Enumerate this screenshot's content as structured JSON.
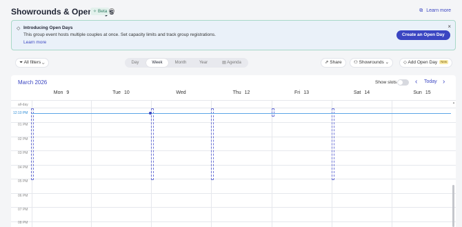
{
  "header": {
    "title": "Showrounds & Open days",
    "beta_label": "Beta",
    "learn_more": "Learn more"
  },
  "banner": {
    "title": "Introducing Open Days",
    "text": "This group event hosts multiple couples at once. Set capacity limits and track group registrations.",
    "link": "Learn more",
    "cta": "Create an Open Day",
    "close": "×"
  },
  "toolbar": {
    "filters": "All filters",
    "views": [
      "Day",
      "Week",
      "Month",
      "Year",
      "Agenda"
    ],
    "active_view": "Week",
    "share": "Share",
    "showrounds": "Showrounds",
    "add_open_day": "Add Open Day",
    "new_badge": "New"
  },
  "calendar": {
    "month": "March 2026",
    "show_slots": "Show slots",
    "show_slots_on": false,
    "today": "Today",
    "days": [
      {
        "name": "Mon",
        "num": "9",
        "today": false
      },
      {
        "name": "Tue",
        "num": "10",
        "today": false
      },
      {
        "name": "Wed",
        "num": "11",
        "today": true
      },
      {
        "name": "Thu",
        "num": "12",
        "today": false
      },
      {
        "name": "Fri",
        "num": "13",
        "today": false
      },
      {
        "name": "Sat",
        "num": "14",
        "today": false
      },
      {
        "name": "Sun",
        "num": "15",
        "today": false
      }
    ],
    "allday_label": "all-day",
    "now_label": "12:10 PM",
    "times": [
      "01 PM",
      "02 PM",
      "03 PM",
      "04 PM",
      "05 PM",
      "06 PM",
      "07 PM",
      "08 PM"
    ]
  },
  "colors": {
    "accent": "#3b46c2",
    "banner_bg": "#eaf1f9",
    "banner_border": "#a8d8c8",
    "now_line": "#5aa5e6"
  }
}
